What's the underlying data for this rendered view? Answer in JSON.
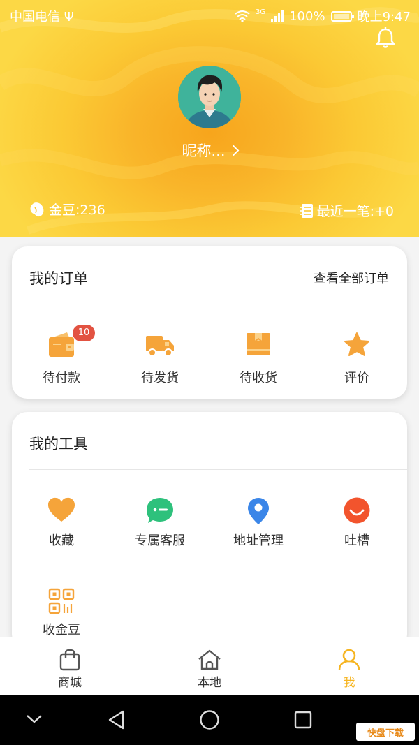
{
  "status_bar": {
    "carrier": "中国电信",
    "network": "3G",
    "battery": "100%",
    "time": "晚上9:47"
  },
  "profile": {
    "nickname": "昵称...",
    "beans_text": "金豆:236",
    "recent_text": "最近一笔:+0"
  },
  "orders": {
    "title": "我的订单",
    "view_all": "查看全部订单",
    "items": [
      {
        "label": "待付款",
        "icon": "wallet-icon",
        "badge": "10"
      },
      {
        "label": "待发货",
        "icon": "truck-icon"
      },
      {
        "label": "待收货",
        "icon": "package-icon"
      },
      {
        "label": "评价",
        "icon": "star-icon"
      }
    ]
  },
  "tools": {
    "title": "我的工具",
    "items": [
      {
        "label": "收藏",
        "icon": "heart-icon"
      },
      {
        "label": "专属客服",
        "icon": "chat-icon"
      },
      {
        "label": "地址管理",
        "icon": "location-pin-icon"
      },
      {
        "label": "吐槽",
        "icon": "smile-icon"
      },
      {
        "label": "收金豆",
        "icon": "qr-code-icon"
      }
    ]
  },
  "tabbar": {
    "items": [
      {
        "label": "商城",
        "icon": "shopping-bag-icon"
      },
      {
        "label": "本地",
        "icon": "home-icon"
      },
      {
        "label": "我",
        "icon": "person-icon",
        "active": true
      }
    ]
  },
  "watermark": {
    "text": "快盘下载"
  },
  "colors": {
    "accent": "#f6b521",
    "orange_icon": "#f5a43a",
    "green_icon": "#2ec17c",
    "blue_icon": "#3b86e8",
    "red_icon": "#f2542d",
    "badge": "#e25241"
  }
}
